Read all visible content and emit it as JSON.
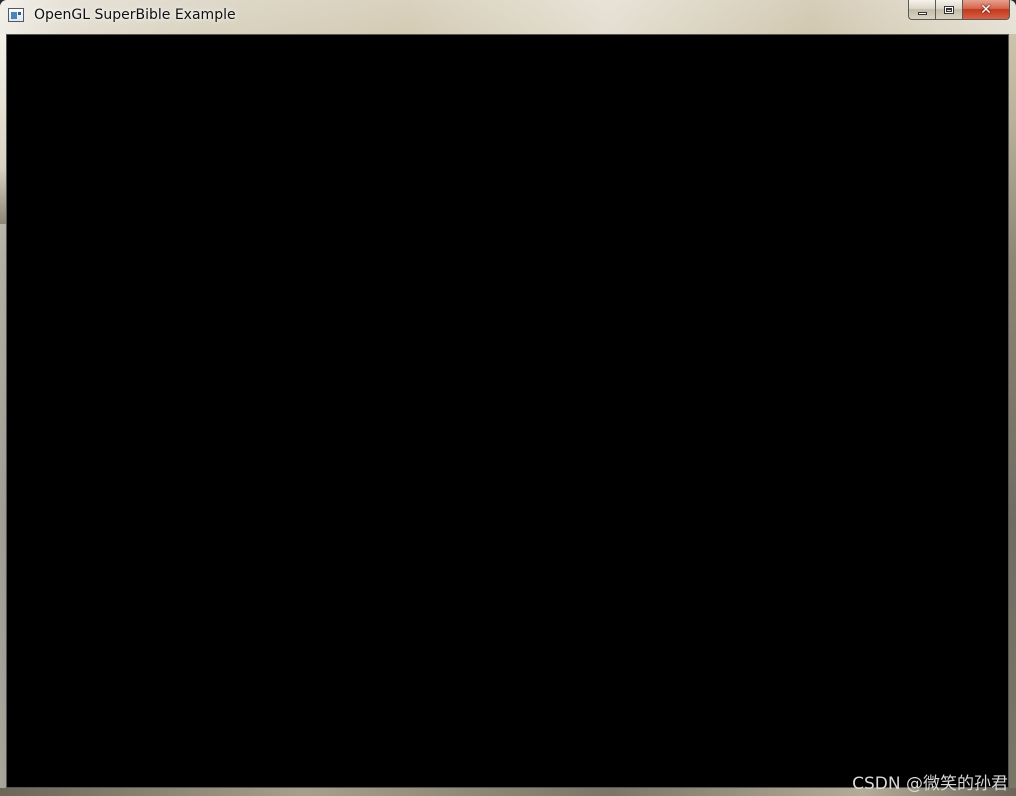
{
  "window": {
    "title": "OpenGL SuperBible Example",
    "icon": "app-window-icon"
  },
  "caption_buttons": {
    "minimize_icon": "minimize-icon",
    "maximize_icon": "maximize-icon",
    "close_glyph": "✕"
  },
  "client": {
    "background_color": "#000000"
  },
  "watermark": {
    "text": "CSDN @微笑的孙君"
  }
}
